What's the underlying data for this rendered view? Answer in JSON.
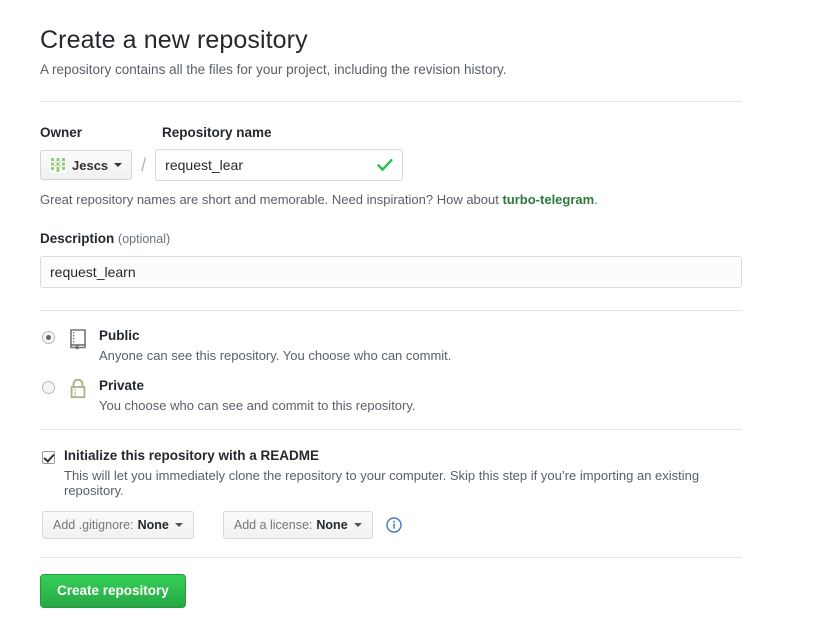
{
  "header": {
    "title": "Create a new repository",
    "subtitle": "A repository contains all the files for your project, including the revision history."
  },
  "name_section": {
    "owner_label": "Owner",
    "repo_label": "Repository name",
    "owner_value": "Jescs",
    "separator": "/",
    "repo_value": "request_lear",
    "repo_placeholder": "",
    "valid_icon": "green-check-icon",
    "hint_prefix": "Great repository names are short and memorable. Need inspiration? How about ",
    "hint_link": "turbo-telegram",
    "hint_suffix": "."
  },
  "description": {
    "label": "Description",
    "optional": "(optional)",
    "value": "request_learn",
    "placeholder": ""
  },
  "visibility": {
    "options": [
      {
        "title": "Public",
        "desc": "Anyone can see this repository. You choose who can commit.",
        "icon": "repo-book-icon",
        "selected": true
      },
      {
        "title": "Private",
        "desc": "You choose who can see and commit to this repository.",
        "icon": "lock-icon",
        "selected": false
      }
    ]
  },
  "readme": {
    "title": "Initialize this repository with a README",
    "desc": "This will let you immediately clone the repository to your computer. Skip this step if you’re importing an existing repository.",
    "checked": true,
    "gitignore": {
      "label": "Add .gitignore:",
      "value": "None"
    },
    "license": {
      "label": "Add a license:",
      "value": "None"
    },
    "info_icon": "info-circle-icon"
  },
  "submit": {
    "label": "Create repository"
  },
  "colors": {
    "green_accent": "#2cbe4e",
    "green_button": "#28a745",
    "green_link": "#2b7a39",
    "info_blue": "#4078c0",
    "lock_khaki": "#b3b087",
    "repo_gray": "#767676",
    "divider": "#e5e5e5",
    "muted_text": "#586069"
  }
}
